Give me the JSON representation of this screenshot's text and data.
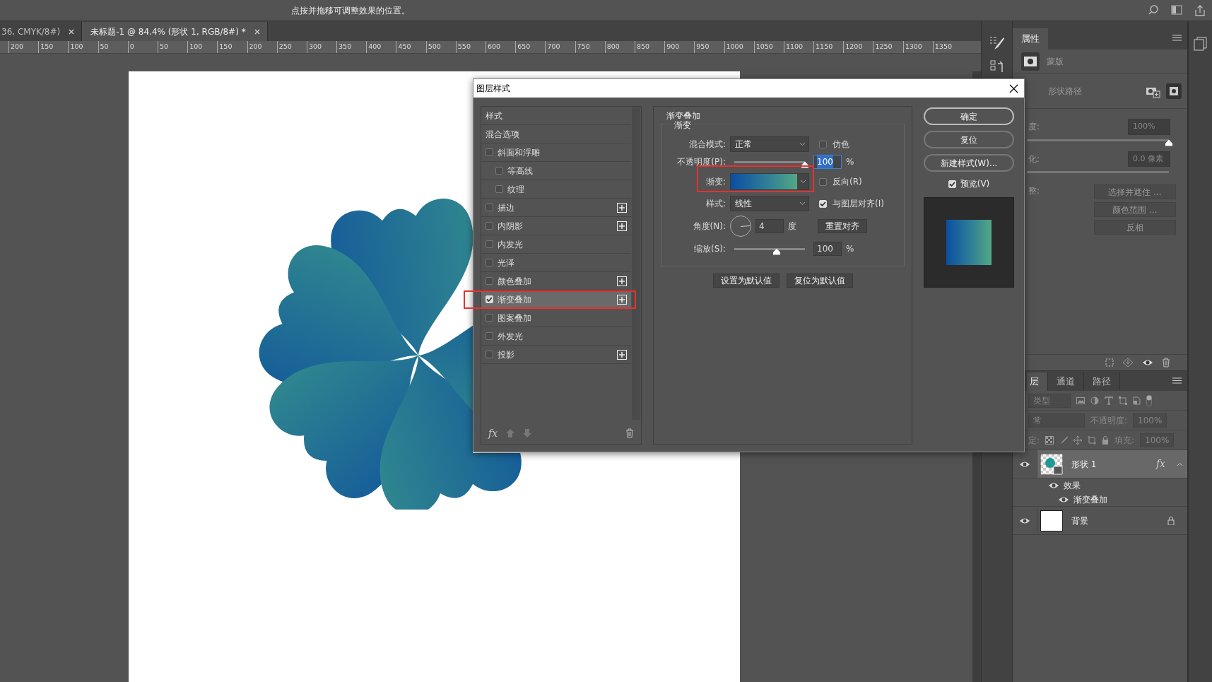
{
  "hint": "点按并拖移可调整效果的位置。",
  "doc_tabs": [
    {
      "label": "36, CMYK/8#)",
      "selected": false
    },
    {
      "label": "未标题-1 @ 84.4% (形状 1, RGB/8#) *",
      "selected": true
    }
  ],
  "ruler": [
    "200",
    "150",
    "100",
    "50",
    "0",
    "50",
    "100",
    "150",
    "200",
    "250",
    "300",
    "350",
    "400",
    "450",
    "500",
    "550",
    "600",
    "650",
    "700",
    "750",
    "800",
    "850",
    "900",
    "950",
    "1000",
    "1050",
    "1100",
    "1150",
    "1200",
    "1250",
    "1300",
    "1350"
  ],
  "dialog": {
    "title": "图层样式",
    "styles": [
      {
        "kind": "header",
        "label": "样式"
      },
      {
        "kind": "header",
        "label": "混合选项"
      },
      {
        "kind": "effect",
        "label": "斜面和浮雕",
        "checked": false,
        "selected": false,
        "add": false,
        "children": [
          {
            "kind": "effect",
            "label": "等高线",
            "checked": false,
            "selected": false,
            "add": false
          },
          {
            "kind": "effect",
            "label": "纹理",
            "checked": false,
            "selected": false,
            "add": false
          }
        ]
      },
      {
        "kind": "effect",
        "label": "描边",
        "checked": false,
        "selected": false,
        "add": true
      },
      {
        "kind": "effect",
        "label": "内阴影",
        "checked": false,
        "selected": false,
        "add": true
      },
      {
        "kind": "effect",
        "label": "内发光",
        "checked": false,
        "selected": false,
        "add": false
      },
      {
        "kind": "effect",
        "label": "光泽",
        "checked": false,
        "selected": false,
        "add": false
      },
      {
        "kind": "effect",
        "label": "颜色叠加",
        "checked": false,
        "selected": false,
        "add": true
      },
      {
        "kind": "effect",
        "label": "渐变叠加",
        "checked": true,
        "selected": true,
        "add": true
      },
      {
        "kind": "effect",
        "label": "图案叠加",
        "checked": false,
        "selected": false,
        "add": false
      },
      {
        "kind": "effect",
        "label": "外发光",
        "checked": false,
        "selected": false,
        "add": false
      },
      {
        "kind": "effect",
        "label": "投影",
        "checked": false,
        "selected": false,
        "add": true
      }
    ],
    "footer_fx": "fx",
    "section": "渐变叠加",
    "subsection": "渐变",
    "blend": {
      "label": "混合模式:",
      "value": "正常"
    },
    "dither": {
      "label": "仿色",
      "checked": false
    },
    "opacity": {
      "label": "不透明度(P):",
      "level": 1,
      "value": "100",
      "unit": "%"
    },
    "gradient_label": "渐变:",
    "reverse": {
      "label": "反向(R)",
      "checked": false
    },
    "style": {
      "label": "样式:",
      "value": "线性"
    },
    "align": {
      "label": "与图层对齐(I)",
      "checked": true
    },
    "angle": {
      "label": "角度(N):",
      "value": "4",
      "unit": "度",
      "button": "重置对齐"
    },
    "scale": {
      "label": "缩放(S):",
      "level": 0.6,
      "value": "100",
      "unit": "%"
    },
    "default_buttons": [
      "设置为默认值",
      "复位为默认值"
    ],
    "actions": [
      "确定",
      "复位",
      "新建样式(W)..."
    ],
    "preview": {
      "label": "预览(V)",
      "checked": true
    }
  },
  "properties": {
    "tab": "属性",
    "mask_label": "蒙版",
    "path_label": "形状路径",
    "density": {
      "label": "度:",
      "value": "100%",
      "level": 1
    },
    "feather": {
      "label": "化:",
      "value": "0.0 像素"
    },
    "refine_label": "整:",
    "buttons": [
      "选择并遮住 ...",
      "颜色范围 ...",
      "反相"
    ]
  },
  "layers": {
    "tabs": [
      {
        "label": "层",
        "selected": true
      },
      {
        "label": "通道",
        "selected": false
      },
      {
        "label": "路径",
        "selected": false
      }
    ],
    "filter": "类型",
    "blend": "常",
    "opacity_label": "不透明度:",
    "opacity": "100%",
    "lock_label": "定:",
    "fill_label": "填充:",
    "fill": "100%",
    "items": [
      {
        "kind": "shape",
        "name": "形状 1",
        "selected": true,
        "fx": "fx",
        "locked": false,
        "effects_label": "效果",
        "effects": [
          "渐变叠加"
        ]
      },
      {
        "kind": "background",
        "name": "背景",
        "selected": false,
        "locked": true
      }
    ]
  }
}
